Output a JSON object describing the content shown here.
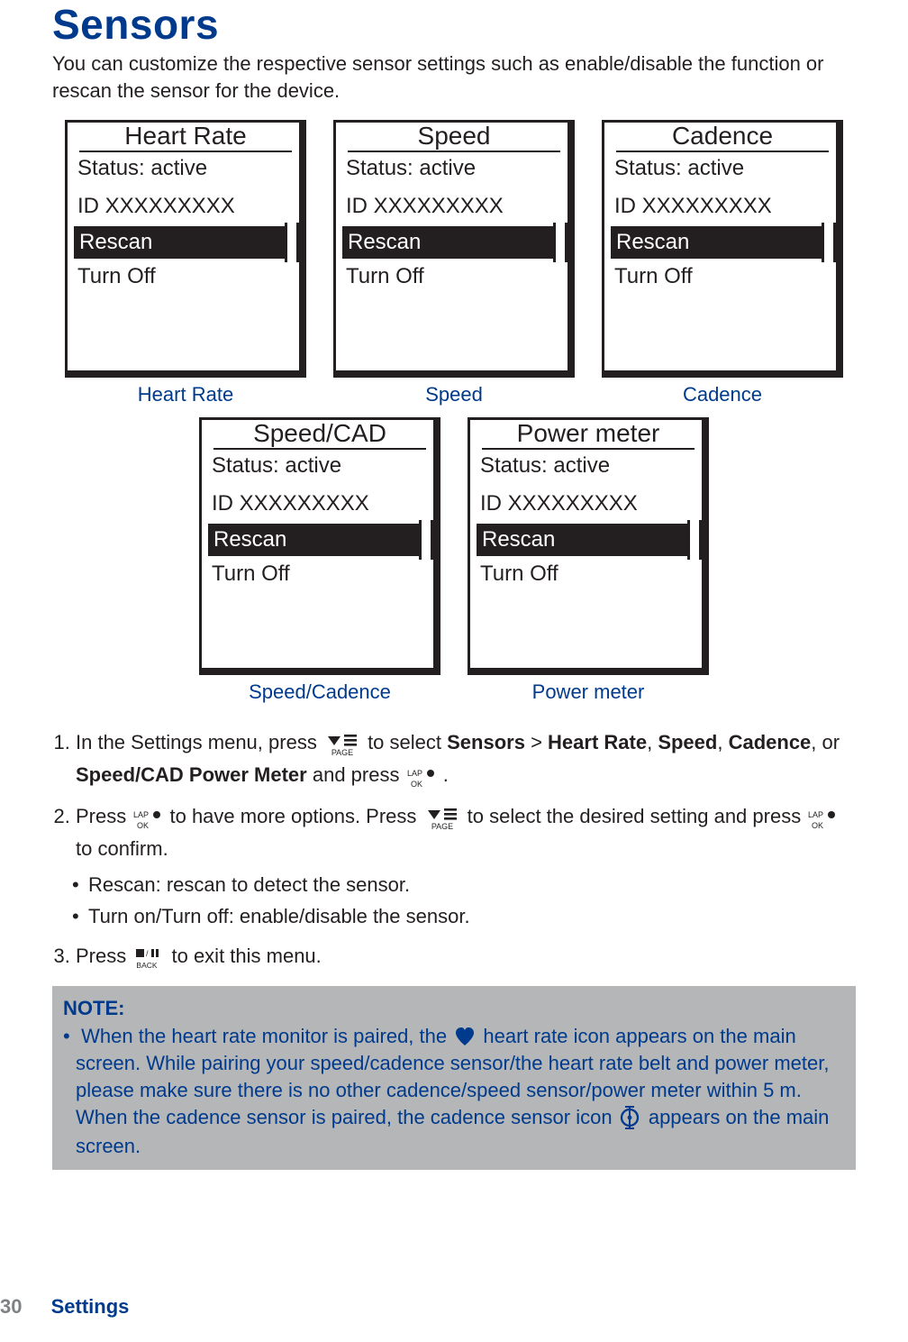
{
  "title": "Sensors",
  "intro": "You can customize the respective sensor settings such as enable/disable the function or rescan the sensor for the device.",
  "screens": [
    {
      "title": "Heart Rate",
      "status": "Status: active",
      "id": "ID XXXXXXXXX",
      "rescan": "Rescan",
      "turnoff": "Turn Off",
      "caption": "Heart Rate"
    },
    {
      "title": "Speed",
      "status": "Status: active",
      "id": "ID XXXXXXXXX",
      "rescan": "Rescan",
      "turnoff": "Turn Off",
      "caption": "Speed"
    },
    {
      "title": "Cadence",
      "status": "Status: active",
      "id": "ID XXXXXXXXX",
      "rescan": "Rescan",
      "turnoff": "Turn Off",
      "caption": "Cadence"
    },
    {
      "title": "Speed/CAD",
      "status": "Status: active",
      "id": "ID XXXXXXXXX",
      "rescan": "Rescan",
      "turnoff": "Turn Off",
      "caption": "Speed/Cadence"
    },
    {
      "title": "Power meter",
      "status": "Status: active",
      "id": "ID XXXXXXXXX",
      "rescan": "Rescan",
      "turnoff": "Turn Off",
      "caption": "Power meter"
    }
  ],
  "steps": {
    "s1a": "In the Settings menu, press ",
    "s1b": " to select ",
    "s1_sensors": "Sensors",
    "s1_gt": " > ",
    "s1_hr": "Heart Rate",
    "s1_c1": ", ",
    "s1_speed": "Speed",
    "s1_c2": ", ",
    "s1_cad": "Cadence",
    "s1_or": ", or ",
    "s1_scpm": "Speed/CAD Power Meter",
    "s1_and": " and press ",
    "s1_end": ".",
    "s2a": "Press ",
    "s2b": " to have more options. Press ",
    "s2c": " to select the desired setting and press ",
    "s2d": " to confirm.",
    "s2_sub1": "Rescan: rescan to detect the sensor.",
    "s2_sub2": "Turn on/Turn off: enable/disable the sensor.",
    "s3a": "Press ",
    "s3b": " to exit this menu."
  },
  "note": {
    "title": "NOTE:",
    "p1a": "When the heart rate monitor is paired, the ",
    "p1b": " heart rate icon appears on the main screen. While pairing your speed/cadence sensor/the heart rate belt and power meter, please make sure there is no other cadence/speed sensor/power meter within 5 m. When the cadence sensor is paired, the cadence sensor icon ",
    "p1c": " appears on the main screen."
  },
  "footer": {
    "page": "30",
    "section": "Settings"
  }
}
